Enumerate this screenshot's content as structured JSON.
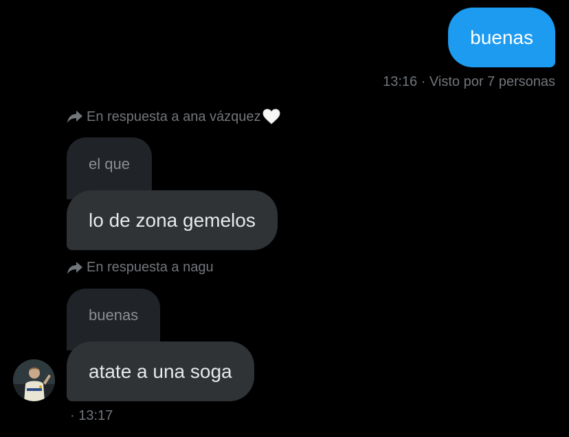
{
  "colors": {
    "background": "#000000",
    "outgoing_bubble": "#1d9bf0",
    "incoming_bubble": "#2f3336",
    "quote_bubble": "#202327",
    "meta_text": "#71767b"
  },
  "outgoing": {
    "text": "buenas",
    "time": "13:16",
    "seen": "· Visto por 7 personas"
  },
  "replies": [
    {
      "context_label": "En respuesta a ana vázquez",
      "context_emoji": "🤍",
      "quoted_text": "el que",
      "message": "lo de zona gemelos"
    },
    {
      "context_label": "En respuesta a nagu",
      "quoted_text": "buenas",
      "message": "atate a una soga"
    }
  ],
  "incoming_time": "· 13:17",
  "icons": {
    "reply": "reply-arrow-icon",
    "heart": "white-heart-emoji",
    "avatar": "user-avatar"
  }
}
